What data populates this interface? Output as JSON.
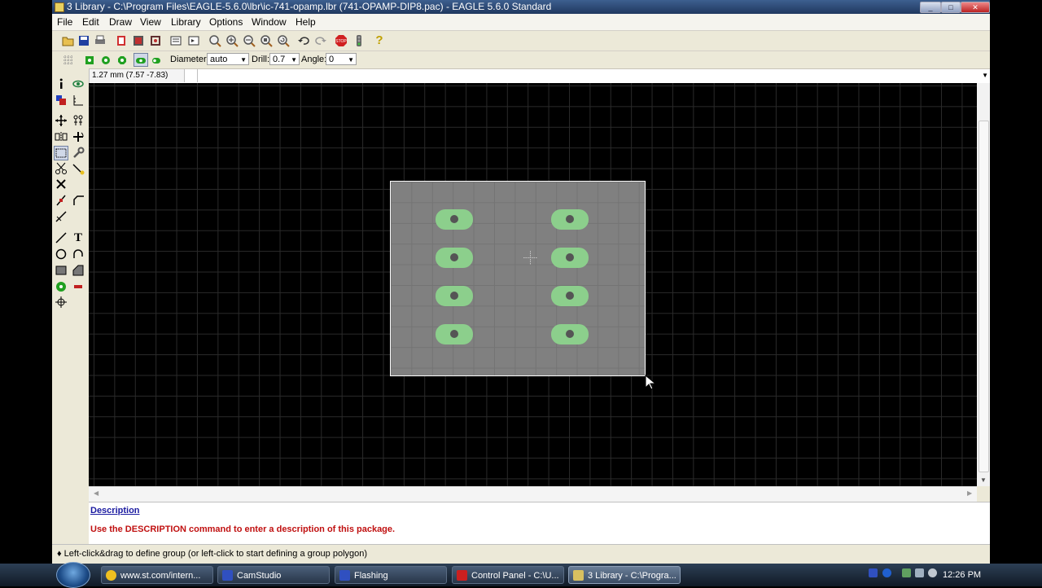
{
  "window": {
    "title": "3 Library - C:\\Program Files\\EAGLE-5.6.0\\lbr\\ic-741-opamp.lbr (741-OPAMP-DIP8.pac) - EAGLE 5.6.0 Standard",
    "minimize": "_",
    "maximize": "□",
    "close": "✕"
  },
  "menubar": {
    "items": [
      "File",
      "Edit",
      "Draw",
      "View",
      "Library",
      "Options",
      "Window",
      "Help"
    ]
  },
  "toolbar1": {
    "icons": [
      "open-icon",
      "save-icon",
      "print-icon",
      "cam-icon",
      "board-icon",
      "schematic-icon",
      "script-icon",
      "run-icon",
      "zoom-fit-icon",
      "zoom-in-icon",
      "zoom-out-icon",
      "zoom-select-icon",
      "redraw-icon",
      "undo-icon",
      "redo-icon",
      "stop-icon",
      "go-icon",
      "help-icon"
    ],
    "stop_label": "STOP",
    "help_label": "?"
  },
  "toolbar2": {
    "diameter_label": "Diameter:",
    "diameter_value": "auto",
    "drill_label": "Drill:",
    "drill_value": "0.7",
    "angle_label": "Angle:",
    "angle_value": "0",
    "pad_shapes": [
      "square",
      "round",
      "octagon",
      "long",
      "offset"
    ],
    "active_pad_shape": "long"
  },
  "command": {
    "coordinates": "1.27 mm (7.57 -7.83)",
    "input_value": ""
  },
  "tools": [
    {
      "left": "info",
      "right": "show"
    },
    {
      "left": "display",
      "right": "mark"
    },
    {
      "left": "move",
      "right": "copy"
    },
    {
      "left": "mirror",
      "right": "rotate"
    },
    {
      "left": "group",
      "right": "change"
    },
    {
      "left": "cut",
      "right": "paste"
    },
    {
      "left": "delete",
      "right": ""
    },
    {
      "left": "split",
      "right": "miter"
    },
    {
      "left": "optimize",
      "right": ""
    },
    {
      "left": "wire",
      "right": "text"
    },
    {
      "left": "circle",
      "right": "arc"
    },
    {
      "left": "rect",
      "right": "polygon"
    },
    {
      "left": "pad",
      "right": "smd"
    },
    {
      "left": "hole",
      "right": ""
    }
  ],
  "canvas": {
    "background": "#000000",
    "grid_color": "#2a2a2a",
    "selection_fill": "#808080",
    "pad_color": "#8ccf8c",
    "drill_color": "#555555",
    "pads": [
      {
        "col": 0,
        "row": 0
      },
      {
        "col": 1,
        "row": 0
      },
      {
        "col": 0,
        "row": 1
      },
      {
        "col": 1,
        "row": 1
      },
      {
        "col": 0,
        "row": 2
      },
      {
        "col": 1,
        "row": 2
      },
      {
        "col": 0,
        "row": 3
      },
      {
        "col": 1,
        "row": 3
      }
    ]
  },
  "description": {
    "title": "Description",
    "text": "Use the DESCRIPTION command to enter a description of this package."
  },
  "status": {
    "text": "♦ Left-click&drag to define group (or left-click to start defining a group polygon)"
  },
  "taskbar": {
    "tasks": [
      {
        "label": "www.st.com/intern...",
        "color": "#f0c020"
      },
      {
        "label": "CamStudio",
        "color": "#3050c0"
      },
      {
        "label": "Flashing",
        "color": "#3050c0"
      },
      {
        "label": "Control Panel - C:\\U...",
        "color": "#cc2020"
      },
      {
        "label": "3 Library - C:\\Progra...",
        "color": "#d8c060"
      }
    ],
    "clock": "12:26 PM"
  }
}
